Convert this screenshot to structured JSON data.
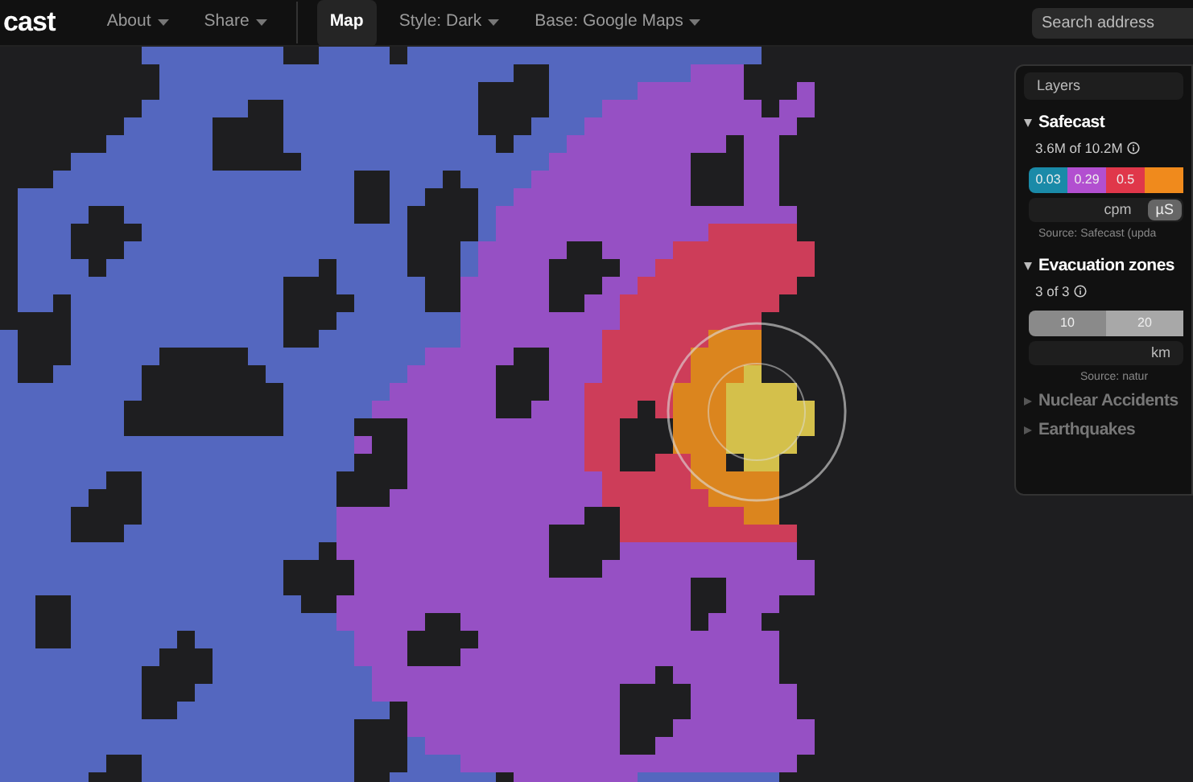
{
  "top_bar": {
    "logo": "cast",
    "menu": [
      {
        "label": "About",
        "dropdown": true,
        "selected": false
      },
      {
        "label": "Share",
        "dropdown": true,
        "selected": false
      },
      {
        "label": "Map",
        "dropdown": false,
        "selected": true
      },
      {
        "label": "Style: Dark",
        "dropdown": true,
        "selected": false
      },
      {
        "label": "Base: Google Maps",
        "dropdown": true,
        "selected": false
      }
    ],
    "search": {
      "placeholder": "Search address"
    }
  },
  "layers_panel": {
    "title": "Layers",
    "layers": [
      {
        "name": "Safecast",
        "expanded": true,
        "count": "3.6M of 10.2M",
        "legend": [
          {
            "label": "0.03",
            "color": "#1a8aa8"
          },
          {
            "label": "0.29",
            "color": "#b24fd0"
          },
          {
            "label": "0.5",
            "color": "#e0374a"
          },
          {
            "color": "#f08a1c"
          }
        ],
        "units": [
          {
            "label": "cpm",
            "selected": false
          },
          {
            "label": "µS",
            "selected": true
          }
        ],
        "source": "Source: Safecast (upda"
      },
      {
        "name": "Evacuation zones",
        "expanded": true,
        "count": "3 of 3",
        "legend": [
          {
            "label": "10",
            "color": "#8a8a8a"
          },
          {
            "label": "20",
            "color": "#a8a8a8"
          }
        ],
        "units": [
          {
            "label": "km",
            "selected": false
          }
        ],
        "source": "Source: natur"
      },
      {
        "name": "Nuclear Accidents",
        "expanded": false
      },
      {
        "name": "Earthquakes",
        "expanded": false
      }
    ]
  }
}
